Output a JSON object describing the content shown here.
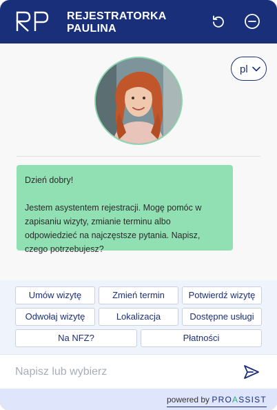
{
  "header": {
    "logo_text": "RP",
    "title_line1": "REJESTRATORKA",
    "title_line2": "PAULINA",
    "reset_icon": "refresh-icon",
    "minimize_icon": "minus-circle-icon"
  },
  "language": {
    "current": "pl"
  },
  "avatar": {
    "alt": "Paulina avatar"
  },
  "message": {
    "greeting": "Dzień dobry!",
    "body": "Jestem asystentem rejestracji. Mogę pomóc w zapisaniu wizyty, zmianie terminu albo odpowiedzieć na najczęstsze pytania. Napisz, czego potrzebujesz?"
  },
  "quick_replies": [
    "Umów wizytę",
    "Zmień termin",
    "Potwierdź wizytę",
    "Odwołaj wizytę",
    "Lokalizacja",
    "Dostępne usługi",
    "Na NFZ?",
    "Płatności"
  ],
  "composer": {
    "placeholder": "Napisz lub wybierz",
    "value": ""
  },
  "footer": {
    "powered_by": "powered by",
    "brand_pre": "PRO",
    "brand_a": "A",
    "brand_post": "SSIST"
  },
  "colors": {
    "header_bg": "#1a2f7a",
    "bubble_bg": "#91e0b4",
    "accent": "#1a2f7a",
    "footer_bg": "#dfe5fb"
  }
}
